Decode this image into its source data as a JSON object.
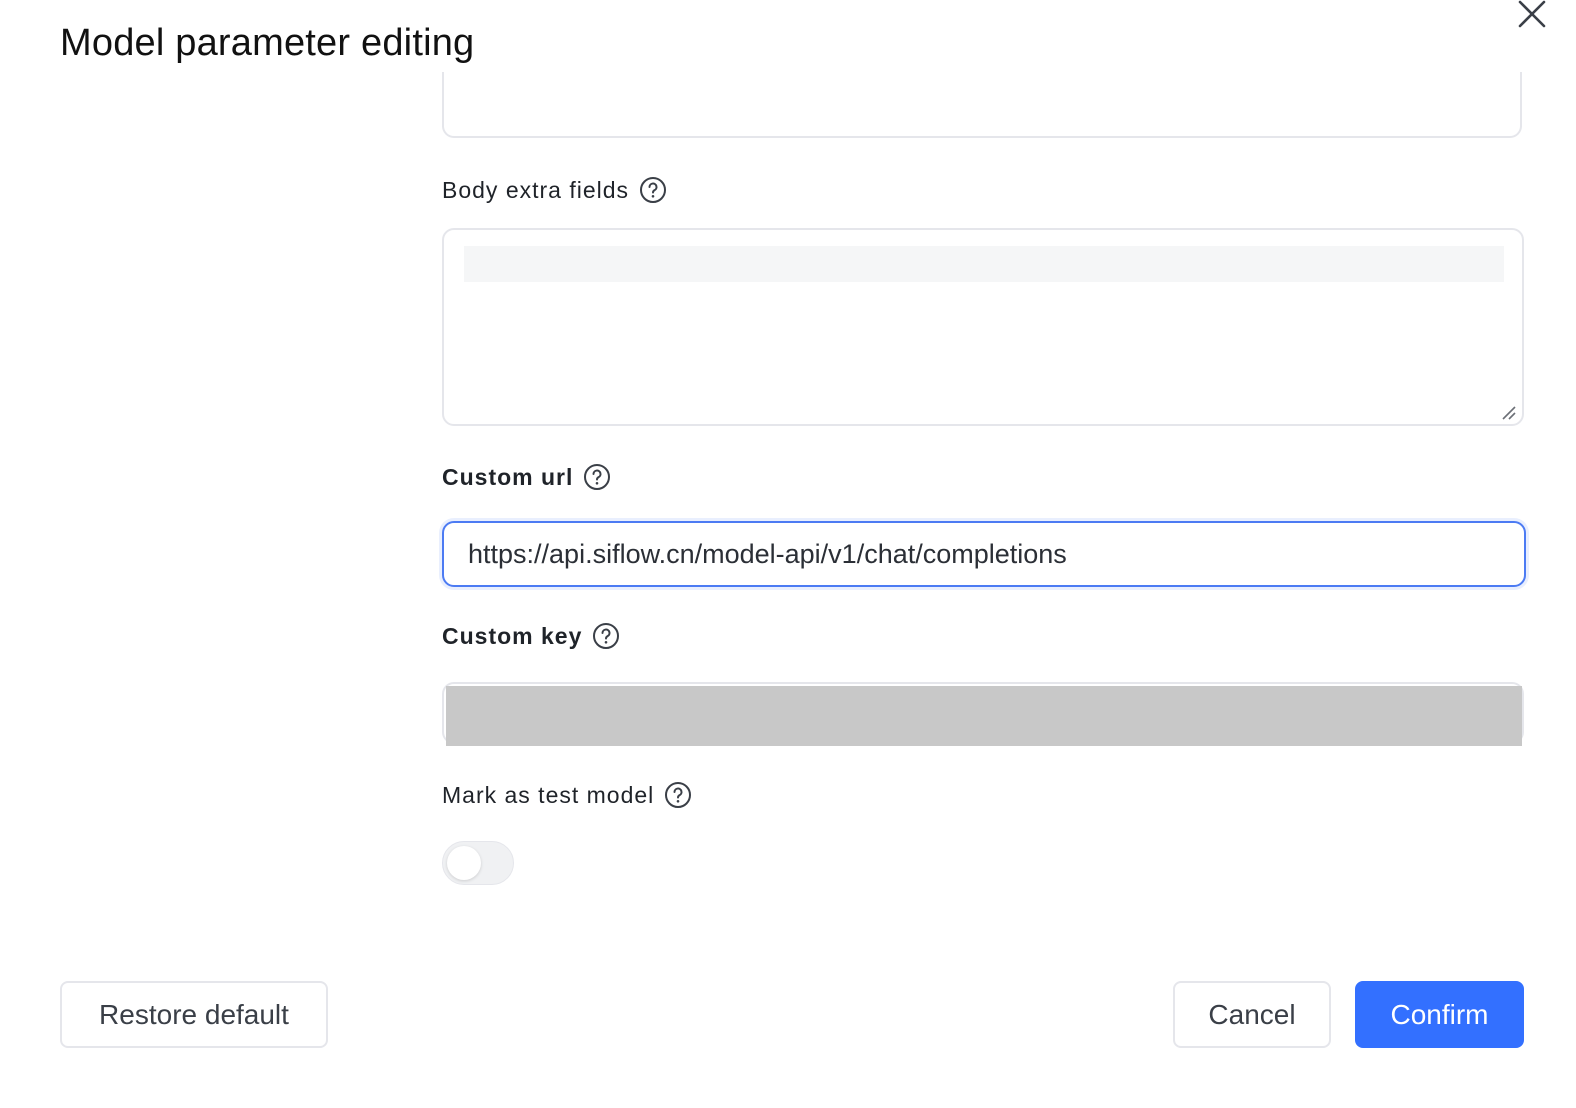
{
  "dialog": {
    "title": "Model parameter editing"
  },
  "fields": {
    "body_extra": {
      "label": "Body extra fields"
    },
    "custom_url": {
      "label": "Custom url",
      "value": "https://api.siflow.cn/model-api/v1/chat/completions"
    },
    "custom_key": {
      "label": "Custom key"
    },
    "test_model": {
      "label": "Mark as test model",
      "enabled": false
    }
  },
  "buttons": {
    "restore": "Restore default",
    "cancel": "Cancel",
    "confirm": "Confirm"
  },
  "colors": {
    "primary": "#3370ff",
    "focus_border": "#4c7bf3",
    "border": "#e5e6eb",
    "text": "#1f2329"
  },
  "icons": {
    "close": "close-icon",
    "help": "help-circle-icon"
  }
}
